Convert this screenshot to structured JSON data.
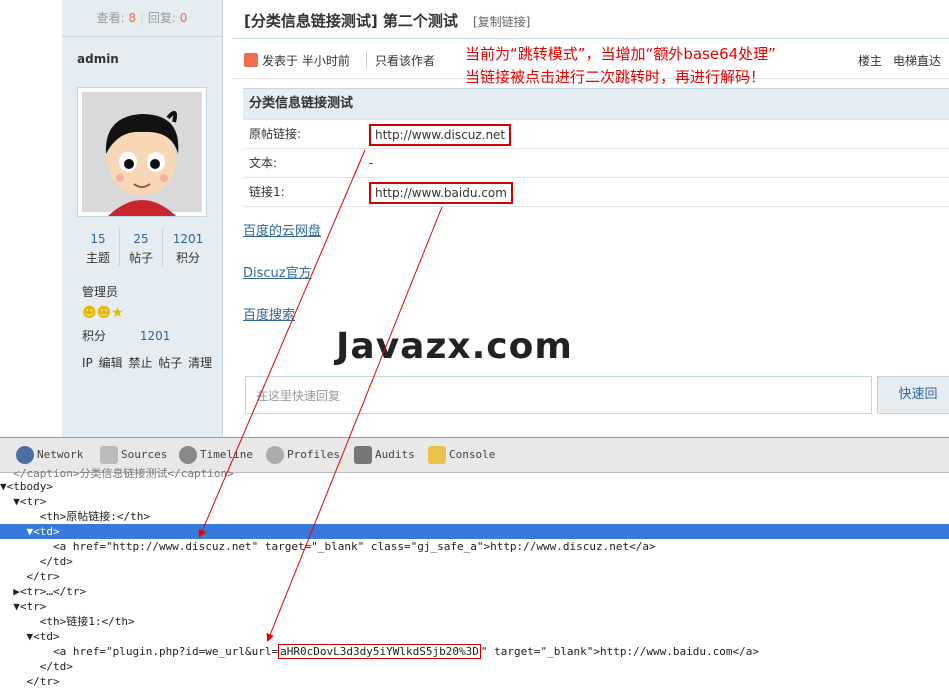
{
  "thread": {
    "views_label": "查看:",
    "views": "8",
    "replies_label": "回复:",
    "replies": "0",
    "title": "[分类信息链接测试] 第二个测试",
    "copy_link": "[复制链接]"
  },
  "author": {
    "name": "admin",
    "stats": [
      {
        "value": "15",
        "label": "主题"
      },
      {
        "value": "25",
        "label": "帖子"
      },
      {
        "value": "1201",
        "label": "积分"
      }
    ],
    "group": "管理员",
    "credit_label": "积分",
    "credit_value": "1201",
    "actions": [
      "IP",
      "编辑",
      "禁止",
      "帖子",
      "清理"
    ]
  },
  "post_meta": {
    "posted": "发表于 半小时前",
    "only_author": "只看该作者",
    "floor_owner": "楼主",
    "elevator": "电梯直达"
  },
  "notes": {
    "line1": "当前为“跳转模式”，当增加“额外base64处理”",
    "line2": "当链接被点击进行二次跳转时，再进行解码！"
  },
  "info_table": {
    "caption": "分类信息链接测试",
    "rows": [
      {
        "label": "原帖链接:",
        "value": "http://www.discuz.net"
      },
      {
        "label": "文本:",
        "value": "-"
      },
      {
        "label": "链接1:",
        "value": "http://www.baidu.com"
      }
    ]
  },
  "body_links": [
    "百度的云网盘",
    "Discuz官方",
    "百度搜索"
  ],
  "watermark": "Javazx.com",
  "reply": {
    "placeholder": "在这里快速回复",
    "button": "快速回"
  },
  "devtools": {
    "tabs": [
      {
        "label": "Network",
        "icon": "network-icon"
      },
      {
        "label": "Sources",
        "icon": "sources-icon"
      },
      {
        "label": "Timeline",
        "icon": "timeline-icon"
      },
      {
        "label": "Profiles",
        "icon": "profiles-icon"
      },
      {
        "label": "Audits",
        "icon": "audits-icon"
      },
      {
        "label": "Console",
        "icon": "console-icon"
      }
    ],
    "code": {
      "l0": "  </caption>分类信息链接测试</caption>",
      "l1": "▼<tbody>",
      "l2": "  ▼<tr>",
      "l3": "      <th>原帖链接:</th>",
      "l4_prefix": "    ▼<td>",
      "l5_pre": "        <a href=\"http://www.discuz.net\" target=\"_blank\" class=\"gj_safe_a\">http://www.discuz.net</a>",
      "l6": "      </td>",
      "l7": "    </tr>",
      "l8": "  ▶<tr>…</tr>",
      "l9": "  ▼<tr>",
      "l10": "      <th>链接1:</th>",
      "l11": "    ▼<td>",
      "l12_a": "        <a href=\"plugin.php?id=we_url&url=",
      "l12_b64": "aHR0cDovL3d3dy5iYWlkdS5jb20%3D",
      "l12_c": "\" target=\"_blank\">http://www.baidu.com</a>",
      "l13": "      </td>",
      "l14": "    </tr>"
    }
  },
  "colors": {
    "accent": "#369",
    "highlight": "#3879d9",
    "annotation": "#e60000",
    "sidebar_bg": "#e5edf2"
  }
}
